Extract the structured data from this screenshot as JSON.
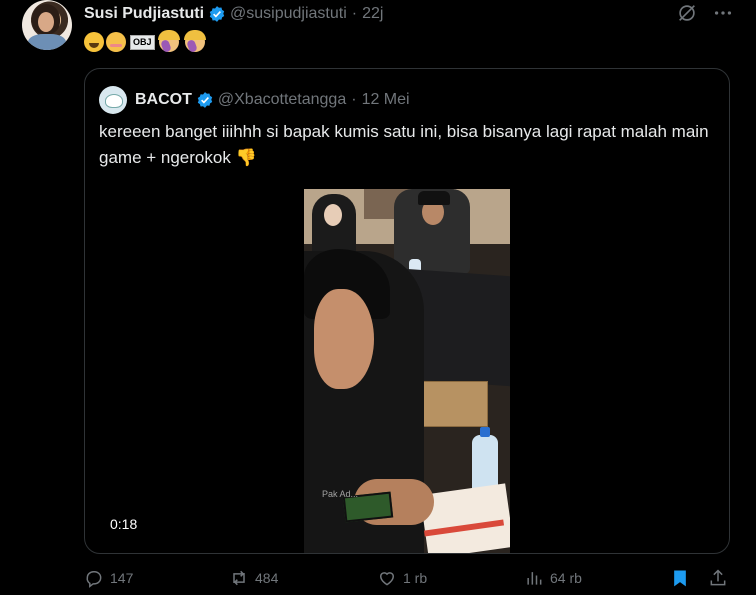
{
  "tweet": {
    "author_name": "Susi Pudjiastuti",
    "handle": "@susipudjiastuti",
    "separator": "·",
    "time": "22j",
    "obj_label": "OBJ"
  },
  "quoted": {
    "author_name": "BACOT",
    "handle": "@Xbacottetangga",
    "separator": "·",
    "date": "12 Mei",
    "text": "kereeen banget iiihhh si bapak kumis satu ini, bisa bisanya lagi rapat malah main game + ngerokok 👎",
    "video_duration": "0:18",
    "video_watermark": "Pak Ad..."
  },
  "actions": {
    "replies": "147",
    "reposts": "484",
    "likes": "1 rb",
    "views": "64 rb"
  },
  "colors": {
    "background": "#000000",
    "text": "#e7e9ea",
    "muted": "#71767b",
    "accent": "#1d9bf0",
    "border": "#2f3336"
  },
  "icons": [
    "verified-badge-icon",
    "grok-icon",
    "more-icon",
    "reply-icon",
    "repost-icon",
    "like-icon",
    "views-icon",
    "bookmark-icon",
    "share-icon"
  ]
}
